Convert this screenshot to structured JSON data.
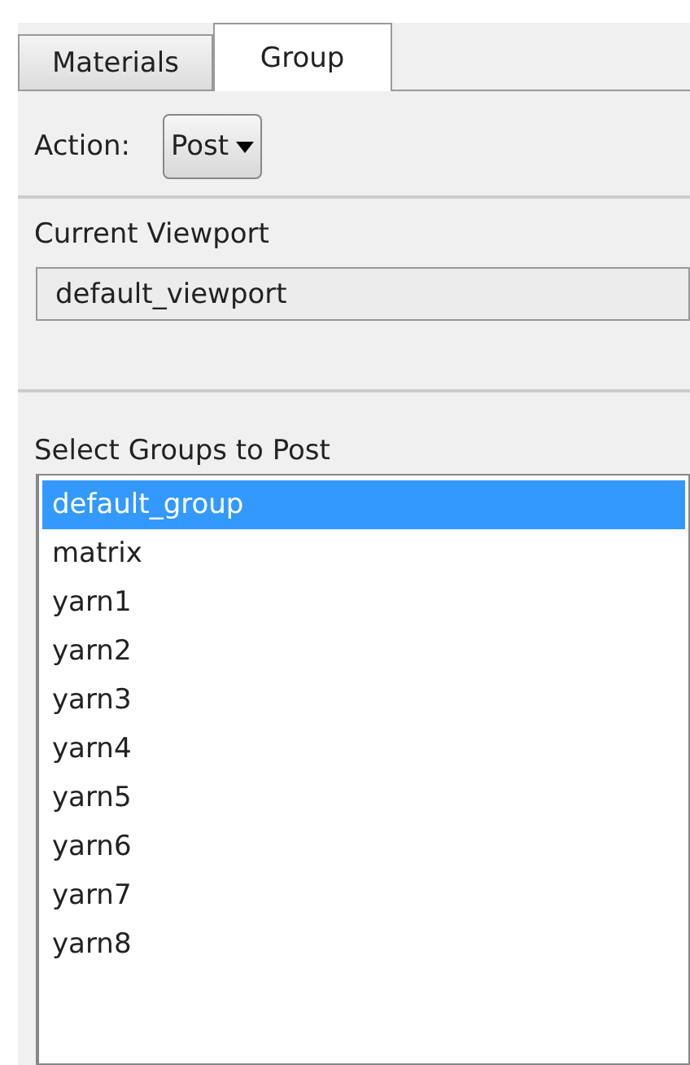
{
  "tabs": [
    {
      "label": "Materials",
      "selected": false
    },
    {
      "label": "Group",
      "selected": true
    }
  ],
  "action": {
    "label": "Action:",
    "value": "Post"
  },
  "viewport": {
    "label": "Current Viewport",
    "value": "default_viewport"
  },
  "groups": {
    "label": "Select Groups to Post",
    "items": [
      {
        "label": "default_group",
        "selected": true
      },
      {
        "label": "matrix",
        "selected": false
      },
      {
        "label": "yarn1",
        "selected": false
      },
      {
        "label": "yarn2",
        "selected": false
      },
      {
        "label": "yarn3",
        "selected": false
      },
      {
        "label": "yarn4",
        "selected": false
      },
      {
        "label": "yarn5",
        "selected": false
      },
      {
        "label": "yarn6",
        "selected": false
      },
      {
        "label": "yarn7",
        "selected": false
      },
      {
        "label": "yarn8",
        "selected": false
      }
    ]
  }
}
